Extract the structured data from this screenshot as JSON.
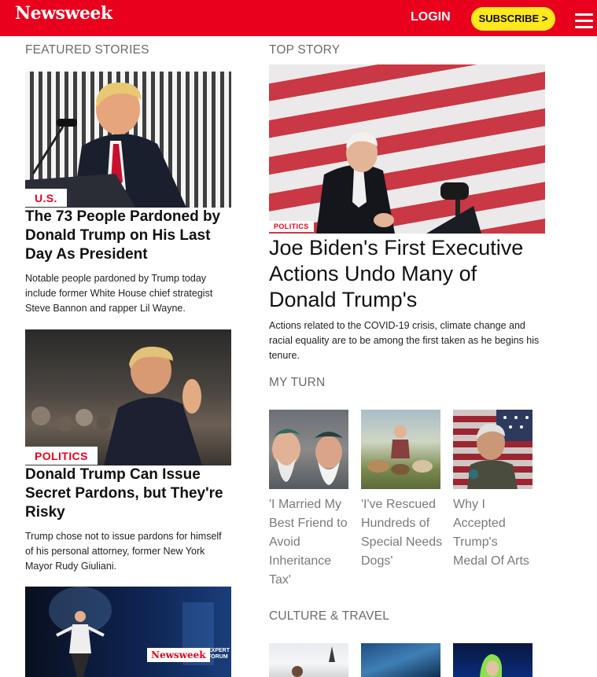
{
  "header": {
    "logo": "Newsweek",
    "login_label": "LOGIN",
    "subscribe_label": "SUBSCRIBE >",
    "brand_color": "#e8001c",
    "subscribe_color": "#ffe81c"
  },
  "featured": {
    "section_label": "FEATURED STORIES",
    "stories": [
      {
        "tag": "U.S.",
        "headline": "The 73 People Pardoned by Donald Trump on His Last Day As President",
        "summary": "Notable people pardoned by Trump today include former White House chief strategist Steve Bannon and rapper Lil Wayne."
      },
      {
        "tag": "POLITICS",
        "headline": "Donald Trump Can Issue Secret Pardons, but They're Risky",
        "summary": "Trump chose not to issue pardons for himself of his personal attorney, former New York Mayor Rudy Giuliani."
      },
      {
        "badge_logo": "Newsweek",
        "badge_text": "EXPERT FORUM"
      }
    ]
  },
  "top_story": {
    "section_label": "TOP STORY",
    "tag": "POLITICS",
    "headline": "Joe Biden's First Executive Actions Undo Many of Donald Trump's",
    "summary": "Actions related to the COVID-19 crisis, climate change and racial equality are to be among the first taken as he begins his tenure."
  },
  "my_turn": {
    "section_label": "MY TURN",
    "items": [
      {
        "title": "'I Married My Best Friend to Avoid Inheritance Tax'"
      },
      {
        "title": "'I've Rescued Hundreds of Special Needs Dogs'"
      },
      {
        "title": "Why I Accepted Trump's Medal Of Arts"
      }
    ]
  },
  "culture_travel": {
    "section_label": "CULTURE & TRAVEL"
  }
}
